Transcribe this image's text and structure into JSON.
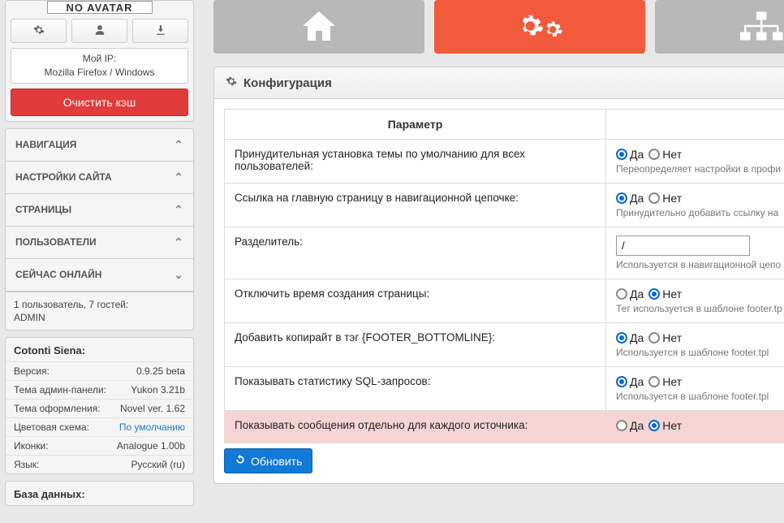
{
  "sidebar": {
    "avatar_text": "NO AVATAR",
    "ip_label": "Мой IP:",
    "ua": "Mozilla Firefox / Windows",
    "clear_cache": "Очистить кэш",
    "accordion": [
      {
        "label": "НАВИГАЦИЯ",
        "open": false
      },
      {
        "label": "НАСТРОЙКИ САЙТА",
        "open": false
      },
      {
        "label": "СТРАНИЦЫ",
        "open": false
      },
      {
        "label": "ПОЛЬЗОВАТЕЛИ",
        "open": false
      },
      {
        "label": "СЕЙЧАС ОНЛАЙН",
        "open": true
      }
    ],
    "online": {
      "summary": "1 пользователь, 7 гостей:",
      "user": "ADMIN"
    },
    "meta_title": "Cotonti Siena:",
    "meta_rows": [
      {
        "k": "Версия:",
        "v": "0.9.25 beta"
      },
      {
        "k": "Тема админ-панели:",
        "v": "Yukon 3.21b"
      },
      {
        "k": "Тема оформления:",
        "v": "Novel ver. 1.62"
      },
      {
        "k": "Цветовая схема:",
        "v": "По умолчанию",
        "link": true
      },
      {
        "k": "Иконки:",
        "v": "Analogue 1.00b"
      },
      {
        "k": "Язык:",
        "v": "Русский (ru)"
      }
    ],
    "db_title": "База данных:"
  },
  "main": {
    "conf_title": "Конфигурация",
    "param_header": "Параметр",
    "yes": "Да",
    "no": "Нет",
    "update_btn": "Обновить",
    "rows": [
      {
        "label": "Принудительная установка темы по умолчанию для всех пользователей:",
        "type": "radio",
        "value": "yes",
        "hint": "Переопределяет настройки в профи"
      },
      {
        "label": "Ссылка на главную страницу в навигационной цепочке:",
        "type": "radio",
        "value": "yes",
        "hint": "Принудительно добавить ссылку на"
      },
      {
        "label": "Разделитель:",
        "type": "text",
        "value": "/",
        "hint": "Используется в навигационной цепо"
      },
      {
        "label": "Отключить время создания страницы:",
        "type": "radio",
        "value": "no",
        "hint": "Тег используется в шаблоне footer.tp"
      },
      {
        "label": "Добавить копирайт в тэг {FOOTER_BOTTOMLINE}:",
        "type": "radio",
        "value": "yes",
        "hint": "Используется в шаблоне footer.tpl"
      },
      {
        "label": "Показывать статистику SQL-запросов:",
        "type": "radio",
        "value": "yes",
        "hint": "Используется в шаблоне footer.tpl"
      },
      {
        "label": "Показывать сообщения отдельно для каждого источника:",
        "type": "radio",
        "value": "no",
        "highlight": true
      }
    ]
  }
}
